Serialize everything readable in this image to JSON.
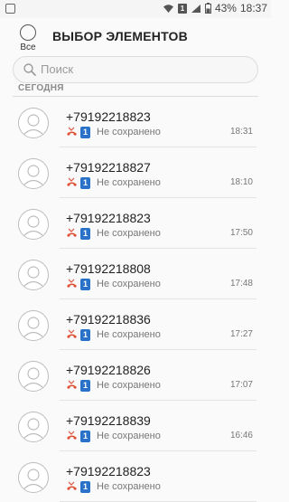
{
  "status_bar": {
    "battery": "43%",
    "time": "18:37",
    "sim_label": "1"
  },
  "header": {
    "select_all_label": "Все",
    "title": "ВЫБОР ЭЛЕМЕНТОВ"
  },
  "search": {
    "placeholder": "Поиск"
  },
  "section_title": "СЕГОДНЯ",
  "colors": {
    "missed_call": "#e0523a",
    "sim_badge": "#2a72c9"
  },
  "calls": [
    {
      "number": "+79192218823",
      "sim": "1",
      "status": "Не сохранено",
      "time": "18:31"
    },
    {
      "number": "+79192218827",
      "sim": "1",
      "status": "Не сохранено",
      "time": "18:10"
    },
    {
      "number": "+79192218823",
      "sim": "1",
      "status": "Не сохранено",
      "time": "17:50"
    },
    {
      "number": "+79192218808",
      "sim": "1",
      "status": "Не сохранено",
      "time": "17:48"
    },
    {
      "number": "+79192218836",
      "sim": "1",
      "status": "Не сохранено",
      "time": "17:27"
    },
    {
      "number": "+79192218826",
      "sim": "1",
      "status": "Не сохранено",
      "time": "17:07"
    },
    {
      "number": "+79192218839",
      "sim": "1",
      "status": "Не сохранено",
      "time": "16:46"
    },
    {
      "number": "+79192218823",
      "sim": "1",
      "status": "Не сохранено",
      "time": ""
    }
  ]
}
